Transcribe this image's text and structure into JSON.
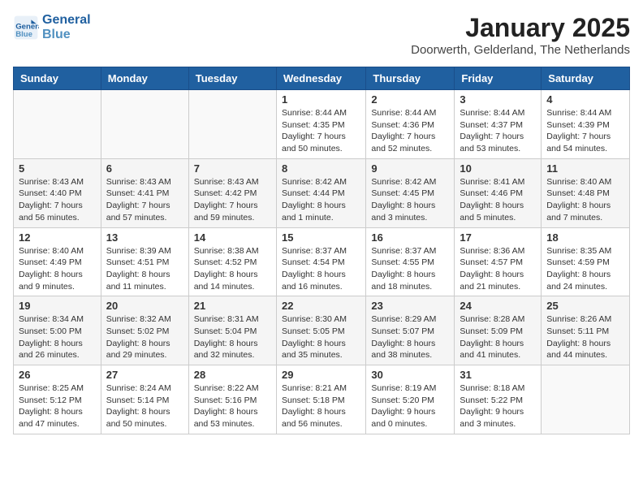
{
  "header": {
    "logo_line1": "General",
    "logo_line2": "Blue",
    "month": "January 2025",
    "location": "Doorwerth, Gelderland, The Netherlands"
  },
  "weekdays": [
    "Sunday",
    "Monday",
    "Tuesday",
    "Wednesday",
    "Thursday",
    "Friday",
    "Saturday"
  ],
  "weeks": [
    [
      {
        "day": "",
        "info": ""
      },
      {
        "day": "",
        "info": ""
      },
      {
        "day": "",
        "info": ""
      },
      {
        "day": "1",
        "info": "Sunrise: 8:44 AM\nSunset: 4:35 PM\nDaylight: 7 hours\nand 50 minutes."
      },
      {
        "day": "2",
        "info": "Sunrise: 8:44 AM\nSunset: 4:36 PM\nDaylight: 7 hours\nand 52 minutes."
      },
      {
        "day": "3",
        "info": "Sunrise: 8:44 AM\nSunset: 4:37 PM\nDaylight: 7 hours\nand 53 minutes."
      },
      {
        "day": "4",
        "info": "Sunrise: 8:44 AM\nSunset: 4:39 PM\nDaylight: 7 hours\nand 54 minutes."
      }
    ],
    [
      {
        "day": "5",
        "info": "Sunrise: 8:43 AM\nSunset: 4:40 PM\nDaylight: 7 hours\nand 56 minutes."
      },
      {
        "day": "6",
        "info": "Sunrise: 8:43 AM\nSunset: 4:41 PM\nDaylight: 7 hours\nand 57 minutes."
      },
      {
        "day": "7",
        "info": "Sunrise: 8:43 AM\nSunset: 4:42 PM\nDaylight: 7 hours\nand 59 minutes."
      },
      {
        "day": "8",
        "info": "Sunrise: 8:42 AM\nSunset: 4:44 PM\nDaylight: 8 hours\nand 1 minute."
      },
      {
        "day": "9",
        "info": "Sunrise: 8:42 AM\nSunset: 4:45 PM\nDaylight: 8 hours\nand 3 minutes."
      },
      {
        "day": "10",
        "info": "Sunrise: 8:41 AM\nSunset: 4:46 PM\nDaylight: 8 hours\nand 5 minutes."
      },
      {
        "day": "11",
        "info": "Sunrise: 8:40 AM\nSunset: 4:48 PM\nDaylight: 8 hours\nand 7 minutes."
      }
    ],
    [
      {
        "day": "12",
        "info": "Sunrise: 8:40 AM\nSunset: 4:49 PM\nDaylight: 8 hours\nand 9 minutes."
      },
      {
        "day": "13",
        "info": "Sunrise: 8:39 AM\nSunset: 4:51 PM\nDaylight: 8 hours\nand 11 minutes."
      },
      {
        "day": "14",
        "info": "Sunrise: 8:38 AM\nSunset: 4:52 PM\nDaylight: 8 hours\nand 14 minutes."
      },
      {
        "day": "15",
        "info": "Sunrise: 8:37 AM\nSunset: 4:54 PM\nDaylight: 8 hours\nand 16 minutes."
      },
      {
        "day": "16",
        "info": "Sunrise: 8:37 AM\nSunset: 4:55 PM\nDaylight: 8 hours\nand 18 minutes."
      },
      {
        "day": "17",
        "info": "Sunrise: 8:36 AM\nSunset: 4:57 PM\nDaylight: 8 hours\nand 21 minutes."
      },
      {
        "day": "18",
        "info": "Sunrise: 8:35 AM\nSunset: 4:59 PM\nDaylight: 8 hours\nand 24 minutes."
      }
    ],
    [
      {
        "day": "19",
        "info": "Sunrise: 8:34 AM\nSunset: 5:00 PM\nDaylight: 8 hours\nand 26 minutes."
      },
      {
        "day": "20",
        "info": "Sunrise: 8:32 AM\nSunset: 5:02 PM\nDaylight: 8 hours\nand 29 minutes."
      },
      {
        "day": "21",
        "info": "Sunrise: 8:31 AM\nSunset: 5:04 PM\nDaylight: 8 hours\nand 32 minutes."
      },
      {
        "day": "22",
        "info": "Sunrise: 8:30 AM\nSunset: 5:05 PM\nDaylight: 8 hours\nand 35 minutes."
      },
      {
        "day": "23",
        "info": "Sunrise: 8:29 AM\nSunset: 5:07 PM\nDaylight: 8 hours\nand 38 minutes."
      },
      {
        "day": "24",
        "info": "Sunrise: 8:28 AM\nSunset: 5:09 PM\nDaylight: 8 hours\nand 41 minutes."
      },
      {
        "day": "25",
        "info": "Sunrise: 8:26 AM\nSunset: 5:11 PM\nDaylight: 8 hours\nand 44 minutes."
      }
    ],
    [
      {
        "day": "26",
        "info": "Sunrise: 8:25 AM\nSunset: 5:12 PM\nDaylight: 8 hours\nand 47 minutes."
      },
      {
        "day": "27",
        "info": "Sunrise: 8:24 AM\nSunset: 5:14 PM\nDaylight: 8 hours\nand 50 minutes."
      },
      {
        "day": "28",
        "info": "Sunrise: 8:22 AM\nSunset: 5:16 PM\nDaylight: 8 hours\nand 53 minutes."
      },
      {
        "day": "29",
        "info": "Sunrise: 8:21 AM\nSunset: 5:18 PM\nDaylight: 8 hours\nand 56 minutes."
      },
      {
        "day": "30",
        "info": "Sunrise: 8:19 AM\nSunset: 5:20 PM\nDaylight: 9 hours\nand 0 minutes."
      },
      {
        "day": "31",
        "info": "Sunrise: 8:18 AM\nSunset: 5:22 PM\nDaylight: 9 hours\nand 3 minutes."
      },
      {
        "day": "",
        "info": ""
      }
    ]
  ]
}
